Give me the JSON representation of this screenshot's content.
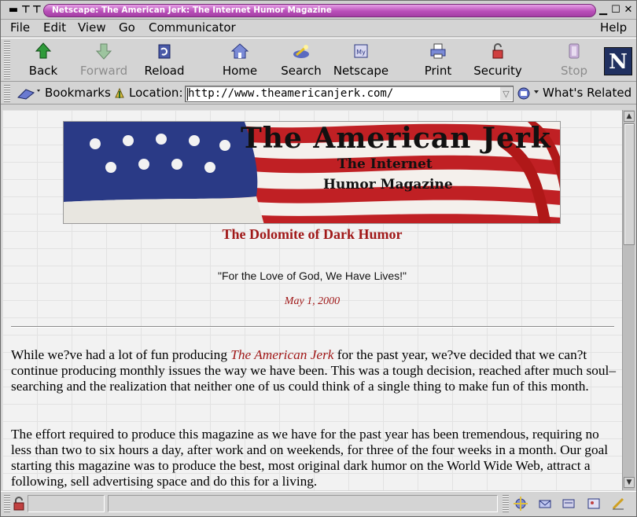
{
  "window": {
    "title": "Netscape: The American Jerk: The Internet Humor Magazine"
  },
  "menu": {
    "items": [
      "File",
      "Edit",
      "View",
      "Go",
      "Communicator"
    ],
    "help": "Help"
  },
  "toolbar": {
    "buttons": [
      {
        "label": "Back",
        "icon": "back-arrow-icon",
        "enabled": true
      },
      {
        "label": "Forward",
        "icon": "forward-arrow-icon",
        "enabled": false
      },
      {
        "label": "Reload",
        "icon": "reload-icon",
        "enabled": true
      },
      {
        "label": "Home",
        "icon": "home-icon",
        "enabled": true
      },
      {
        "label": "Search",
        "icon": "search-icon",
        "enabled": true
      },
      {
        "label": "Netscape",
        "icon": "netscape-icon",
        "enabled": true
      },
      {
        "label": "Print",
        "icon": "printer-icon",
        "enabled": true
      },
      {
        "label": "Security",
        "icon": "padlock-icon",
        "enabled": true
      },
      {
        "label": "Stop",
        "icon": "stop-icon",
        "enabled": false
      }
    ],
    "logo_letter": "N"
  },
  "location": {
    "bookmarks_label": "Bookmarks",
    "location_label": "Location:",
    "url": "http://www.theamericanjerk.com/",
    "related_label": "What's Related"
  },
  "page": {
    "banner": {
      "title": "The American Jerk",
      "line2": "The Internet",
      "line3": "Humor Magazine"
    },
    "tagline": "The Dolomite of Dark Humor",
    "quote": "\"For the Love of God, We Have Lives!\"",
    "date": "May 1, 2000",
    "para1_before": "While we?ve had a lot of fun producing ",
    "para1_title": "The American Jerk",
    "para1_after": " for the past year, we?ve decided that we can?t continue producing monthly issues the way we have been. This was a tough decision, reached after much soul–searching and the realization that neither one of us could think of a single thing to make fun of this month.",
    "para2": "The effort required to produce this magazine as we have for the past year has been tremendous, requiring no less than two to six hours a day, after work and on weekends, for three of the four weeks in a month. Our goal starting this magazine was to produce the best, most original dark humor on the World Wide Web, attract a following, sell advertising space and do this for a living."
  },
  "colors": {
    "title_bar": "#b94fb9",
    "accent_red": "#a01818"
  }
}
